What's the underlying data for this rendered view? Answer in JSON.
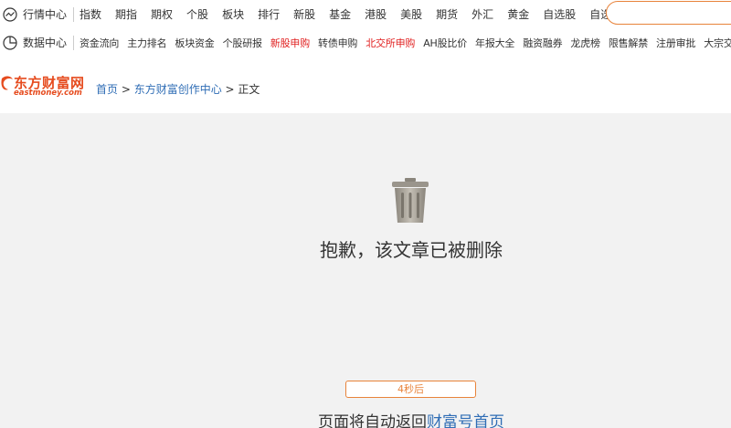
{
  "topnav": {
    "market_center": {
      "title": "行情中心",
      "icon": "line-chart-circle-icon",
      "items": [
        "指数",
        "期指",
        "期权",
        "个股",
        "板块",
        "排行",
        "新股",
        "基金",
        "港股",
        "美股",
        "期货",
        "外汇",
        "黄金",
        "自选股",
        "自选基金"
      ]
    },
    "data_center": {
      "title": "数据中心",
      "icon": "pie-chart-icon",
      "items": [
        {
          "label": "资金流向",
          "highlight": false
        },
        {
          "label": "主力排名",
          "highlight": false
        },
        {
          "label": "板块资金",
          "highlight": false
        },
        {
          "label": "个股研报",
          "highlight": false
        },
        {
          "label": "新股申购",
          "highlight": true
        },
        {
          "label": "转债申购",
          "highlight": false
        },
        {
          "label": "北交所申购",
          "highlight": true
        },
        {
          "label": "AH股比价",
          "highlight": false
        },
        {
          "label": "年报大全",
          "highlight": false
        },
        {
          "label": "融资融券",
          "highlight": false
        },
        {
          "label": "龙虎榜",
          "highlight": false
        },
        {
          "label": "限售解禁",
          "highlight": false
        },
        {
          "label": "注册审批",
          "highlight": false
        },
        {
          "label": "大宗交易",
          "highlight": false
        }
      ]
    },
    "search": {
      "placeholder": ""
    }
  },
  "logo": {
    "cn": "东方财富网",
    "en": "eastmoney.com"
  },
  "breadcrumb": {
    "home": "首页",
    "sep1": " > ",
    "section": "东方财富创作中心",
    "sep2": " > ",
    "current": "正文"
  },
  "main": {
    "icon": "trash-can-icon",
    "message": "抱歉，该文章已被删除",
    "countdown": "4秒后",
    "return_prefix": "页面将自动返回",
    "return_link": "财富号首页"
  },
  "colors": {
    "accent_orange": "#e8833a",
    "logo_red": "#e64c1f",
    "link_blue": "#2f6db5",
    "highlight_red": "#e01f1f",
    "background": "#f2f2f2"
  }
}
